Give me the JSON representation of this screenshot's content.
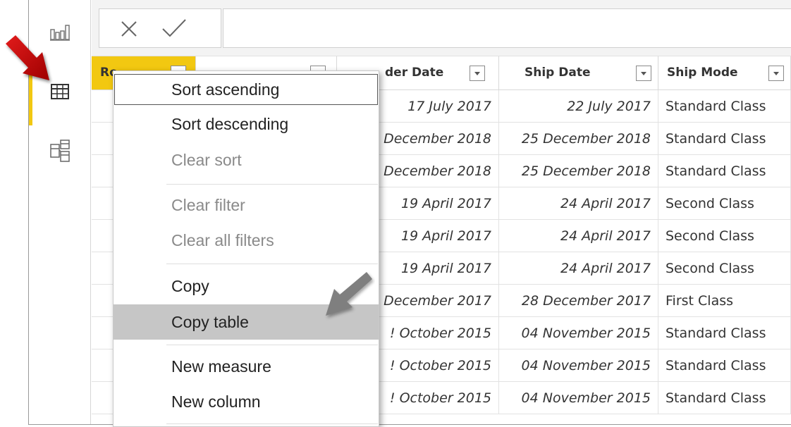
{
  "rail": {
    "items": [
      {
        "name": "report-view",
        "icon": "bar-chart-icon"
      },
      {
        "name": "data-view",
        "icon": "table-icon",
        "active": true
      },
      {
        "name": "model-view",
        "icon": "model-icon"
      }
    ]
  },
  "formula_bar": {
    "cancel_icon": "close-icon",
    "commit_icon": "check-icon",
    "value": ""
  },
  "table": {
    "columns": [
      {
        "label": "Ro"
      },
      {
        "label": ""
      },
      {
        "label": "der Date"
      },
      {
        "label": "Ship Date"
      },
      {
        "label": "Ship Mode"
      }
    ],
    "rows": [
      {
        "order_date": "17 July 2017",
        "ship_date": "22 July 2017",
        "ship_mode": "Standard Class"
      },
      {
        "order_date": "December 2018",
        "ship_date": "25 December 2018",
        "ship_mode": "Standard Class"
      },
      {
        "order_date": "December 2018",
        "ship_date": "25 December 2018",
        "ship_mode": "Standard Class"
      },
      {
        "order_date": "19 April 2017",
        "ship_date": "24 April 2017",
        "ship_mode": "Second Class"
      },
      {
        "order_date": "19 April 2017",
        "ship_date": "24 April 2017",
        "ship_mode": "Second Class"
      },
      {
        "order_date": "19 April 2017",
        "ship_date": "24 April 2017",
        "ship_mode": "Second Class"
      },
      {
        "order_date": "December 2017",
        "ship_date": "28 December 2017",
        "ship_mode": "First Class"
      },
      {
        "order_date": "! October 2015",
        "ship_date": "04 November 2015",
        "ship_mode": "Standard Class"
      },
      {
        "order_date": "! October 2015",
        "ship_date": "04 November 2015",
        "ship_mode": "Standard Class"
      },
      {
        "order_date": "! October 2015",
        "ship_date": "04 November 2015",
        "ship_mode": "Standard Class"
      }
    ]
  },
  "context_menu": {
    "items": [
      {
        "label": "Sort ascending",
        "enabled": true
      },
      {
        "label": "Sort descending",
        "enabled": true
      },
      {
        "label": "Clear sort",
        "enabled": false
      },
      {
        "label": "Clear filter",
        "enabled": false
      },
      {
        "label": "Clear all filters",
        "enabled": false
      },
      {
        "label": "Copy",
        "enabled": true
      },
      {
        "label": "Copy table",
        "enabled": true,
        "highlighted": true
      },
      {
        "label": "New measure",
        "enabled": true
      },
      {
        "label": "New column",
        "enabled": true
      }
    ]
  },
  "annotations": {
    "arrow_red": {
      "color": "#c00000",
      "points_to": "data-view"
    },
    "arrow_gray": {
      "color": "#7f7f7f",
      "points_to": "Copy table"
    }
  },
  "colors": {
    "accent": "#f2c811",
    "menu_hover": "#c6c6c6",
    "disabled_text": "#8a8a8a"
  }
}
